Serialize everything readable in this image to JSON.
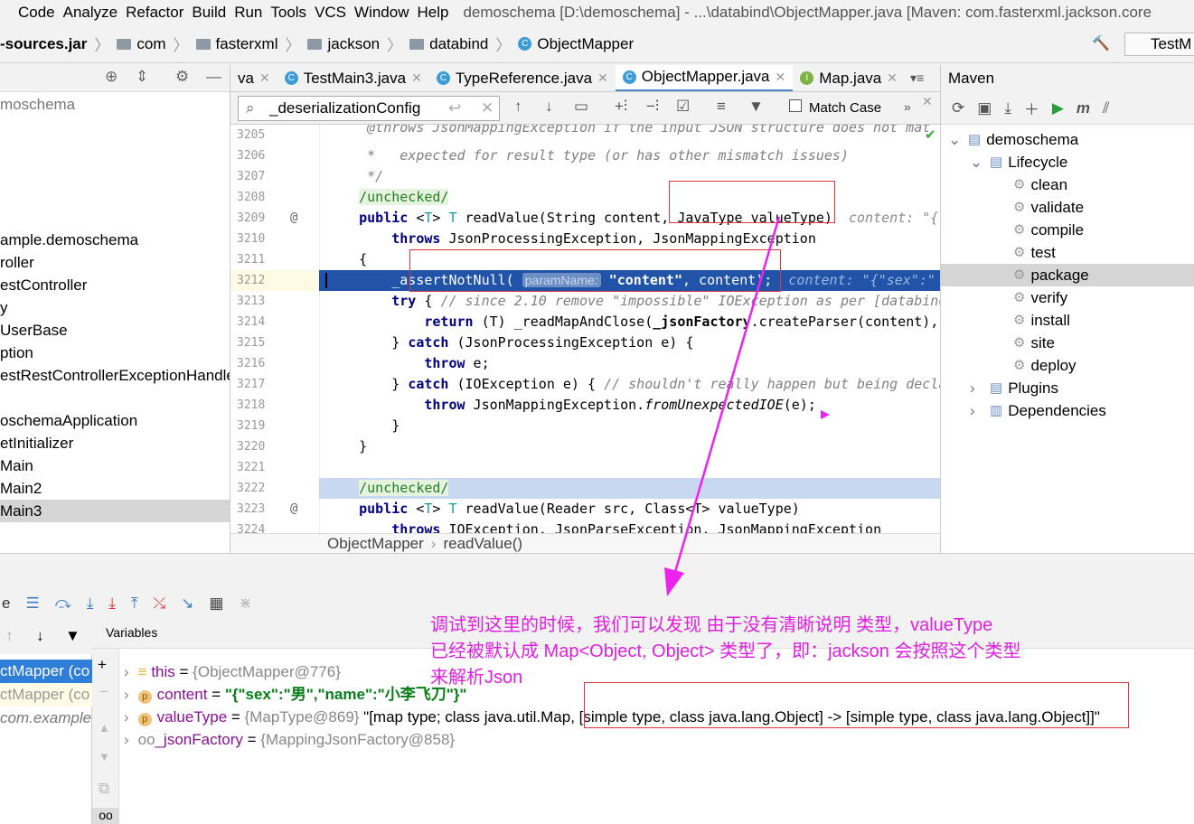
{
  "menu": {
    "items": [
      "Code",
      "Analyze",
      "Refactor",
      "Build",
      "Run",
      "Tools",
      "VCS",
      "Window",
      "Help"
    ],
    "title": "demoschema [D:\\demoschema] - ...\\databind\\ObjectMapper.java [Maven: com.fasterxml.jackson.core"
  },
  "navbar": {
    "crumbs": [
      "-sources.jar",
      "com",
      "fasterxml",
      "jackson",
      "databind",
      "ObjectMapper"
    ],
    "run_config": "TestM"
  },
  "project": {
    "items": [
      "moschema",
      "",
      "",
      "",
      "",
      "",
      "ample.demoschema",
      "roller",
      "estController",
      "y",
      "UserBase",
      "ption",
      "estRestControllerExceptionHandle",
      "",
      "oschemaApplication",
      "etInitializer",
      "Main",
      "Main2",
      "Main3"
    ],
    "selected": 18
  },
  "tabs": [
    {
      "label": "va",
      "icon": ""
    },
    {
      "label": "TestMain3.java",
      "icon": "C"
    },
    {
      "label": "TypeReference.java",
      "icon": "C"
    },
    {
      "label": "ObjectMapper.java",
      "icon": "C",
      "active": true
    },
    {
      "label": "Map.java",
      "icon": "I"
    }
  ],
  "search": {
    "value": "_deserializationConfig",
    "match_case": "Match Case"
  },
  "editor": {
    "lines": [
      {
        "n": "3205",
        "s": [
          [
            "cm",
            "     @throws JsonMappingException if the input JSON structure does not mat"
          ]
        ]
      },
      {
        "n": "3206",
        "s": [
          [
            "cm",
            "     *   expected for result type (or has other mismatch issues)"
          ]
        ]
      },
      {
        "n": "3207",
        "s": [
          [
            "cm",
            "     */"
          ]
        ]
      },
      {
        "n": "3208",
        "s": [
          [
            "",
            "    "
          ],
          [
            "an",
            "/unchecked/"
          ]
        ]
      },
      {
        "n": "3209",
        "at": true,
        "s": [
          [
            "",
            "    "
          ],
          [
            "kw",
            "public"
          ],
          [
            "",
            " <"
          ],
          [
            "tp",
            "T"
          ],
          [
            "",
            "> "
          ],
          [
            "tp",
            "T"
          ],
          [
            "",
            " readValue(String content, JavaType valueType)  "
          ],
          [
            "hint",
            "content: \"{\""
          ]
        ]
      },
      {
        "n": "3210",
        "s": [
          [
            "",
            "        "
          ],
          [
            "kw",
            "throws"
          ],
          [
            "",
            " JsonProcessingException, JsonMappingException"
          ]
        ]
      },
      {
        "n": "3211",
        "s": [
          [
            "",
            "    {"
          ]
        ]
      },
      {
        "n": "3212",
        "exec": true,
        "s": [
          [
            "",
            "        _assertNotNull( "
          ],
          [
            "pn",
            "paramName:"
          ],
          [
            "",
            " "
          ],
          [
            "st",
            "\"content\""
          ],
          [
            "",
            ", content);  "
          ],
          [
            "hint",
            "content: \"{\"sex\":\""
          ]
        ]
      },
      {
        "n": "3213",
        "s": [
          [
            "",
            "        "
          ],
          [
            "kw",
            "try"
          ],
          [
            "",
            " { "
          ],
          [
            "cm",
            "// since 2.10 remove \"impossible\" IOException as per [databind"
          ]
        ]
      },
      {
        "n": "3214",
        "s": [
          [
            "",
            "            "
          ],
          [
            "kw",
            "return"
          ],
          [
            "",
            " (T) _readMapAndClose("
          ],
          [
            "bold",
            "_jsonFactory"
          ],
          [
            "",
            ".createParser(content),"
          ]
        ]
      },
      {
        "n": "3215",
        "s": [
          [
            "",
            "        } "
          ],
          [
            "kw",
            "catch"
          ],
          [
            "",
            " (JsonProcessingException e) {"
          ]
        ]
      },
      {
        "n": "3216",
        "s": [
          [
            "",
            "            "
          ],
          [
            "kw",
            "throw"
          ],
          [
            "",
            " e;"
          ]
        ]
      },
      {
        "n": "3217",
        "s": [
          [
            "",
            "        } "
          ],
          [
            "kw",
            "catch"
          ],
          [
            "",
            " (IOException e) { "
          ],
          [
            "cm",
            "// shouldn't really happen but being decla"
          ]
        ]
      },
      {
        "n": "3218",
        "s": [
          [
            "",
            "            "
          ],
          [
            "kw",
            "throw"
          ],
          [
            "",
            " JsonMappingException."
          ],
          [
            "it",
            "fromUnexpectedIOE"
          ],
          [
            "",
            "(e);"
          ]
        ]
      },
      {
        "n": "3219",
        "s": [
          [
            "",
            "        }"
          ]
        ]
      },
      {
        "n": "3220",
        "s": [
          [
            "",
            "    }"
          ]
        ]
      },
      {
        "n": "3221",
        "s": []
      },
      {
        "n": "3222",
        "blue": true,
        "s": [
          [
            "",
            "    "
          ],
          [
            "an",
            "/unchecked/"
          ]
        ]
      },
      {
        "n": "3223",
        "at": true,
        "s": [
          [
            "",
            "    "
          ],
          [
            "kw",
            "public"
          ],
          [
            "",
            " <"
          ],
          [
            "tp",
            "T"
          ],
          [
            "",
            "> "
          ],
          [
            "tp",
            "T"
          ],
          [
            "",
            " readValue(Reader src, Class<T> valueType)"
          ]
        ]
      },
      {
        "n": "3224",
        "s": [
          [
            "",
            "        "
          ],
          [
            "kw",
            "throws"
          ],
          [
            "",
            " IOException, JsonParseException, JsonMappingException"
          ]
        ]
      }
    ]
  },
  "editor_breadcrumb": {
    "class": "ObjectMapper",
    "method": "readValue()"
  },
  "maven": {
    "title": "Maven",
    "tree": [
      {
        "label": "demoschema",
        "level": 0,
        "icon": "module"
      },
      {
        "label": "Lifecycle",
        "level": 1,
        "icon": "folder",
        "open": true
      },
      {
        "label": "clean",
        "level": 2,
        "icon": "gear"
      },
      {
        "label": "validate",
        "level": 2,
        "icon": "gear"
      },
      {
        "label": "compile",
        "level": 2,
        "icon": "gear"
      },
      {
        "label": "test",
        "level": 2,
        "icon": "gear"
      },
      {
        "label": "package",
        "level": 2,
        "icon": "gear",
        "selected": true
      },
      {
        "label": "verify",
        "level": 2,
        "icon": "gear"
      },
      {
        "label": "install",
        "level": 2,
        "icon": "gear"
      },
      {
        "label": "site",
        "level": 2,
        "icon": "gear"
      },
      {
        "label": "deploy",
        "level": 2,
        "icon": "gear"
      },
      {
        "label": "Plugins",
        "level": 1,
        "icon": "folder"
      },
      {
        "label": "Dependencies",
        "level": 1,
        "icon": "deps"
      }
    ]
  },
  "debugger": {
    "variables_label": "Variables",
    "frames": [
      "ctMapper (co",
      "ctMapper (co",
      "com.example."
    ],
    "variables": [
      {
        "name": "this",
        "eq": " = ",
        "ref": "{ObjectMapper@776}",
        "value": "",
        "icon": "stack"
      },
      {
        "name": "content",
        "eq": " = ",
        "ref": "",
        "value": "\"{\"sex\":\"男\",\"name\":\"小李飞刀\"}\"",
        "icon": "p"
      },
      {
        "name": "valueType",
        "eq": " = ",
        "ref": "{MapType@869}",
        "value": " \"[map type; class java.util.Map, [simple type, class java.lang.Object] -> [simple type, class java.lang.Object]]\"",
        "icon": "p"
      },
      {
        "name": "_jsonFactory",
        "eq": " = ",
        "ref": "{MappingJsonFactory@858}",
        "value": "",
        "icon": "oo"
      }
    ]
  },
  "annotation": {
    "lines": [
      "调试到这里的时候，我们可以发现 由于没有清晰说明 类型，valueType",
      "已经被默认成 Map<Object, Object> 类型了，即：jackson 会按照这个类型",
      "来解析Json"
    ],
    "color": "#e020e0"
  },
  "colors": {
    "exec_line": "#2154a8",
    "highlight_box": "#d9363e",
    "arrow": "#ee22ee"
  }
}
